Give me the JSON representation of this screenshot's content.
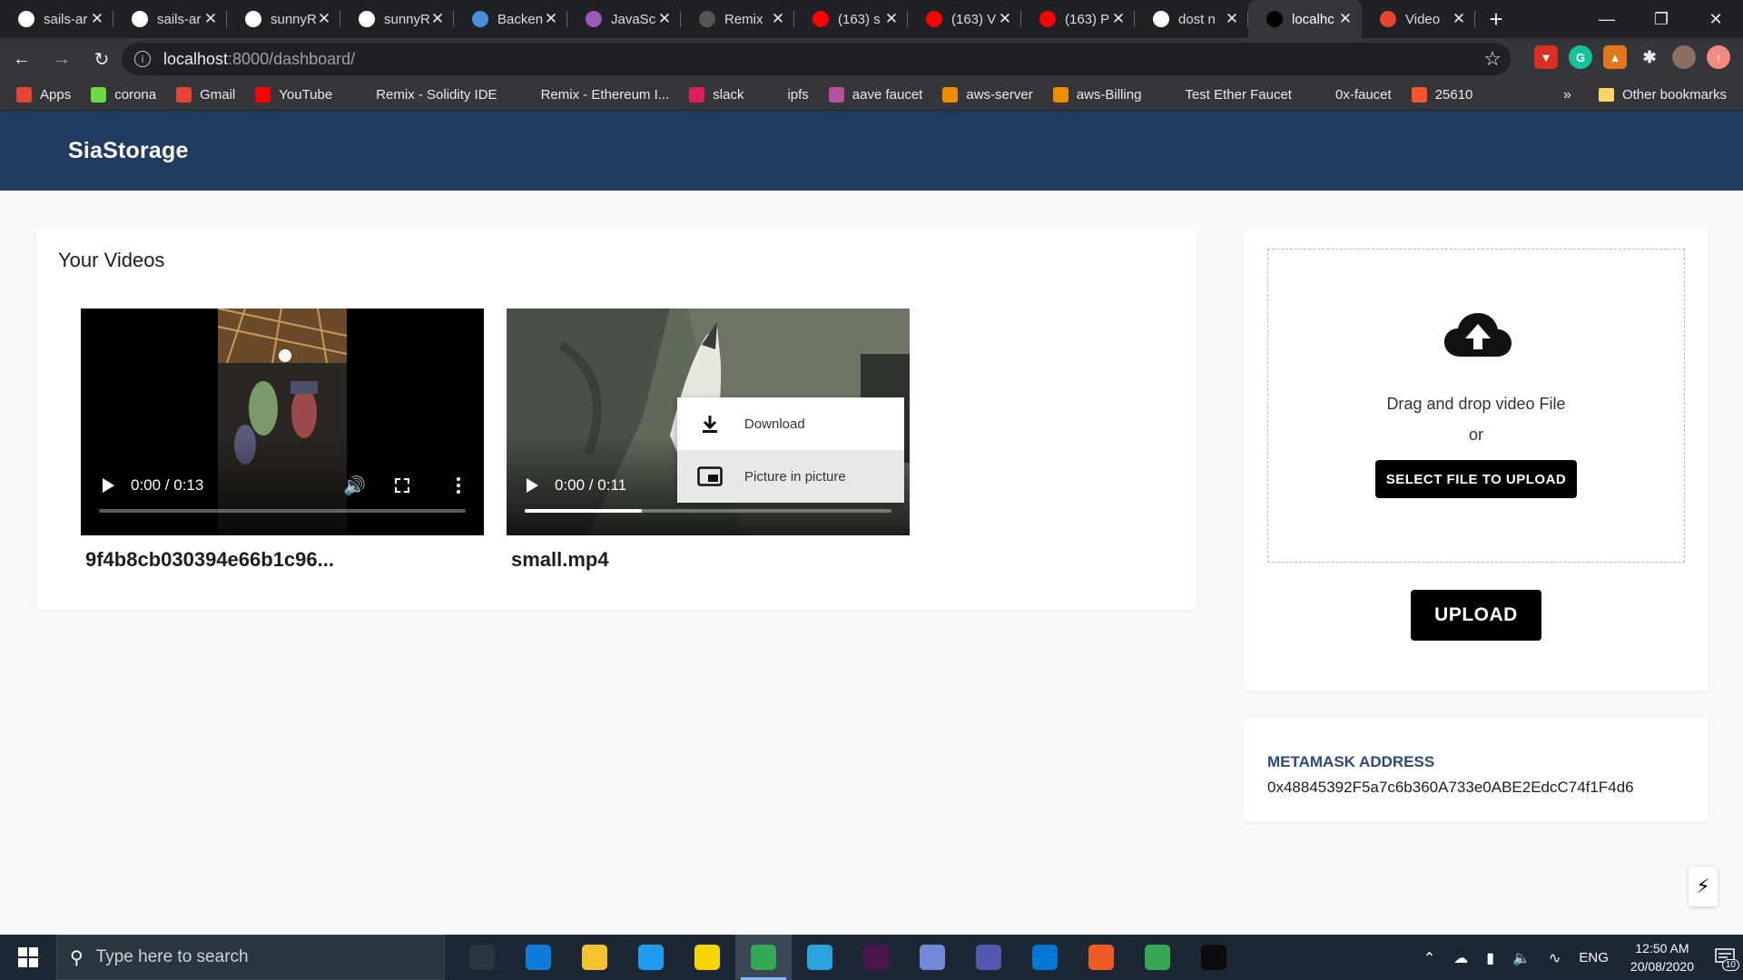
{
  "browser": {
    "tabs": [
      {
        "title": "sails-ar",
        "icon": "github-icon",
        "color": "#ffffff"
      },
      {
        "title": "sails-ar",
        "icon": "github-icon",
        "color": "#ffffff"
      },
      {
        "title": "sunnyR",
        "icon": "github-icon",
        "color": "#ffffff"
      },
      {
        "title": "sunnyR",
        "icon": "github-icon",
        "color": "#ffffff"
      },
      {
        "title": "Backen",
        "icon": "laptop-icon",
        "color": "#4a90d9"
      },
      {
        "title": "JavaSc",
        "icon": "javascript-icon",
        "color": "#9b59b6"
      },
      {
        "title": "Remix",
        "icon": "remix-icon",
        "color": "#555555"
      },
      {
        "title": "(163) s",
        "icon": "youtube-icon",
        "color": "#ff0000"
      },
      {
        "title": "(163) V",
        "icon": "youtube-icon",
        "color": "#ff0000"
      },
      {
        "title": "(163) P",
        "icon": "youtube-icon",
        "color": "#ff0000"
      },
      {
        "title": "dost n",
        "icon": "google-icon",
        "color": "#ffffff"
      },
      {
        "title": "localhc",
        "icon": "triangle-icon",
        "color": "#000000",
        "active": true
      },
      {
        "title": "Video",
        "icon": "gmail-icon",
        "color": "#ea4335"
      }
    ],
    "url_host": "localhost",
    "url_path": ":8000/dashboard/",
    "bookmarks": [
      {
        "label": "Apps",
        "icon": "apps-grid-icon",
        "color": "#ea4335"
      },
      {
        "label": "corona",
        "icon": "upwork-icon",
        "color": "#6fda44"
      },
      {
        "label": "Gmail",
        "icon": "gmail-icon",
        "color": "#ea4335"
      },
      {
        "label": "YouTube",
        "icon": "youtube-icon",
        "color": "#ff0000"
      },
      {
        "label": "Remix - Solidity IDE",
        "icon": "ethereum-icon",
        "color": "#35363a"
      },
      {
        "label": "Remix - Ethereum I...",
        "icon": "remix-icon",
        "color": "#35363a"
      },
      {
        "label": "slack",
        "icon": "slack-icon",
        "color": "#e01e5a"
      },
      {
        "label": "ipfs",
        "icon": "globe-icon",
        "color": "#35363a"
      },
      {
        "label": "aave faucet",
        "icon": "aave-icon",
        "color": "#b6509e"
      },
      {
        "label": "aws-server",
        "icon": "aws-icon",
        "color": "#f08c00"
      },
      {
        "label": "aws-Billing",
        "icon": "aws-icon",
        "color": "#f08c00"
      },
      {
        "label": "Test Ether Faucet",
        "icon": "globe-icon",
        "color": "#35363a"
      },
      {
        "label": "0x-faucet",
        "icon": "github-icon",
        "color": "#35363a"
      },
      {
        "label": "25610",
        "icon": "brave-icon",
        "color": "#fb542b"
      }
    ],
    "other_bookmarks": "Other bookmarks",
    "bookmarks_overflow": "»"
  },
  "app": {
    "brand": "SiaStorage",
    "videos_heading": "Your Videos",
    "videos": [
      {
        "title": "9f4b8cb030394e66b1c96...",
        "time": "0:00 / 0:13",
        "progress": 0.0
      },
      {
        "title": "small.mp4",
        "time": "0:00 / 0:11",
        "progress": 0.32
      }
    ],
    "context_menu": {
      "download": "Download",
      "pip": "Picture in picture"
    },
    "upload": {
      "drag_text": "Drag and drop video File",
      "or_text": "or",
      "select_button": "SELECT FILE TO UPLOAD",
      "upload_button": "UPLOAD"
    },
    "metamask": {
      "label": "METAMASK ADDRESS",
      "address": "0x48845392F5a7c6b360A733e0ABE2EdcC74f1F4d6"
    }
  },
  "taskbar": {
    "search_placeholder": "Type here to search",
    "apps": [
      {
        "name": "task-view-icon",
        "color": "#2b3540"
      },
      {
        "name": "edge-icon",
        "color": "#0f7bd8"
      },
      {
        "name": "file-explorer-icon",
        "color": "#f4c430"
      },
      {
        "name": "vscode-icon",
        "color": "#1f9cf0"
      },
      {
        "name": "sticky-notes-icon",
        "color": "#f7d500"
      },
      {
        "name": "chrome-icon",
        "color": "#34a853",
        "active": true
      },
      {
        "name": "telegram-icon",
        "color": "#2aa3df"
      },
      {
        "name": "slack-icon",
        "color": "#4a154b"
      },
      {
        "name": "discord-icon",
        "color": "#7289da"
      },
      {
        "name": "teams-icon",
        "color": "#5558af"
      },
      {
        "name": "maps-icon",
        "color": "#0078d4"
      },
      {
        "name": "postman-icon",
        "color": "#ef5b25"
      },
      {
        "name": "chrome-profile-icon",
        "color": "#34a853"
      },
      {
        "name": "terminal-icon",
        "color": "#0c0c0c"
      }
    ],
    "lang": "ENG",
    "time": "12:50 AM",
    "date": "20/08/2020",
    "notifications": "10"
  }
}
